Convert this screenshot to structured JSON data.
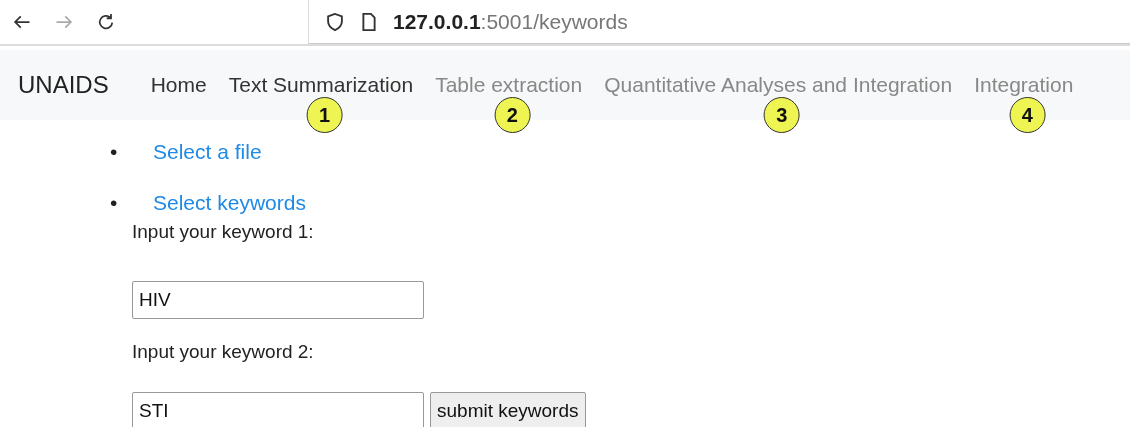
{
  "browser": {
    "url_host": "127.0.0.1",
    "url_path": ":5001/keywords"
  },
  "navbar": {
    "brand": "UNAIDS",
    "items": [
      {
        "label": "Home",
        "disabled": false
      },
      {
        "label": "Text Summarization",
        "disabled": false,
        "callout": "1"
      },
      {
        "label": "Table extraction",
        "disabled": true,
        "callout": "2"
      },
      {
        "label": "Quantitative Analyses and Integration",
        "disabled": true,
        "callout": "3"
      },
      {
        "label": "Integration",
        "disabled": true,
        "callout": "4"
      }
    ]
  },
  "menu": [
    {
      "marker": "•",
      "label": "Select a file"
    },
    {
      "marker": "•",
      "label": "Select keywords"
    }
  ],
  "form": {
    "fields": [
      {
        "label": "Input your keyword 1:",
        "value": "HIV"
      },
      {
        "label": "Input your keyword 2:",
        "value": "STI"
      }
    ],
    "submit": "submit keywords"
  }
}
